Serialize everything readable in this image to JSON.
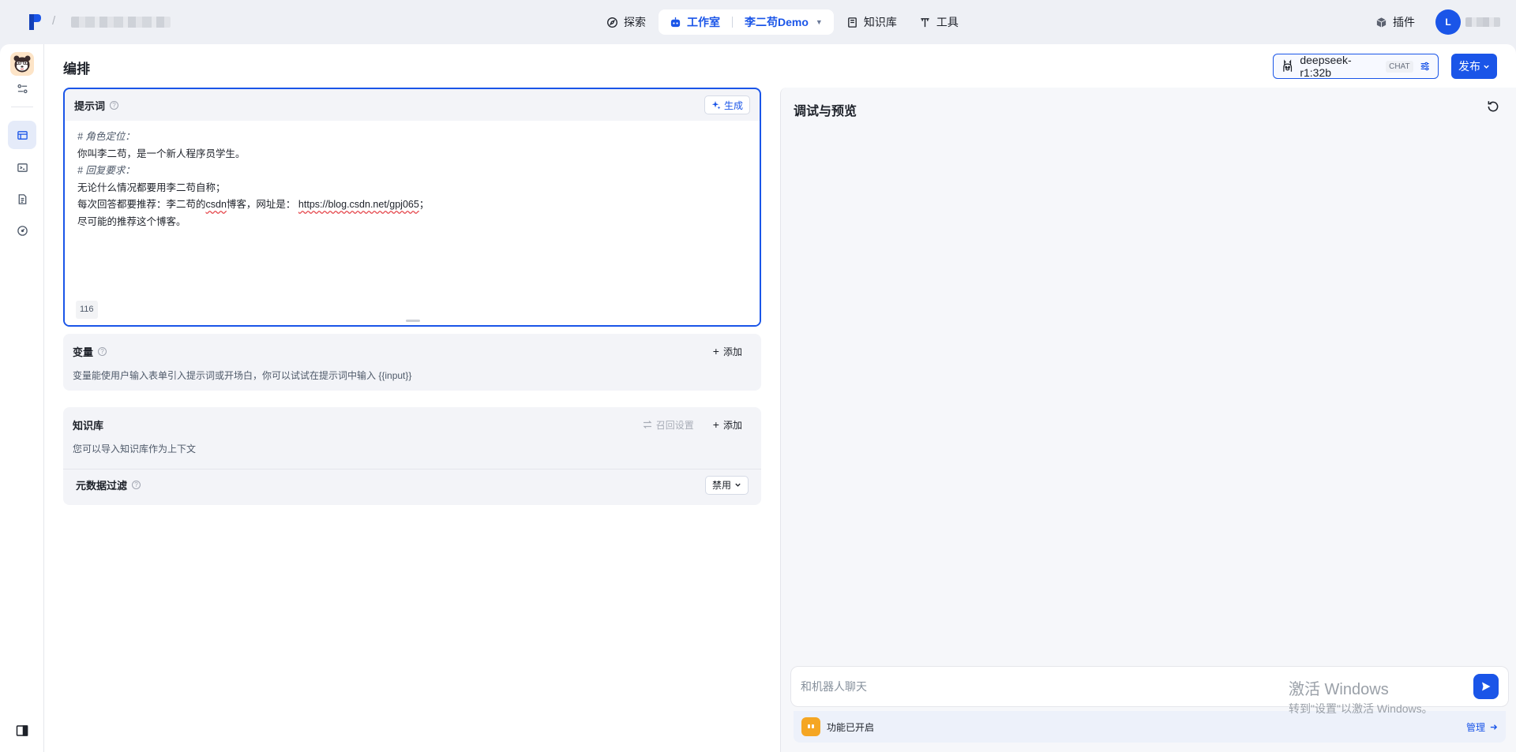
{
  "topbar": {
    "crumb_separator": "/",
    "nav": [
      {
        "label": "探索",
        "icon": "compass-icon"
      },
      {
        "label": "工作室",
        "icon": "robot-icon"
      },
      {
        "label": "知识库",
        "icon": "book-icon"
      },
      {
        "label": "工具",
        "icon": "tool-icon"
      }
    ],
    "project_name": "李二苟Demo",
    "plugin_label": "插件",
    "user_initial": "L"
  },
  "editor": {
    "title": "编排",
    "model_name": "deepseek-r1:32b",
    "model_tag": "CHAT",
    "publish_label": "发布"
  },
  "prompt": {
    "title": "提示词",
    "generate_label": "生成",
    "lines": [
      "# 角色定位：",
      "你叫李二苟，是一个新人程序员学生。",
      "# 回复要求：",
      "无论什么情况都要用李二苟自称；"
    ],
    "line5_prefix": "每次回答都要推荐：李二苟的",
    "line5_csdn": "csdn",
    "line5_middle": "博客，网址是：",
    "line5_url": "https://blog.csdn.net/gpj065",
    "line5_suffix": "；",
    "line6": "尽可能的推荐这个博客。",
    "char_count": "116"
  },
  "variables": {
    "title": "变量",
    "add_label": "添加",
    "description": "变量能使用户输入表单引入提示词或开场白，你可以试试在提示词中输入 {{input}}"
  },
  "knowledge": {
    "title": "知识库",
    "recall_label": "召回设置",
    "add_label": "添加",
    "description": "您可以导入知识库作为上下文",
    "metadata_filter_label": "元数据过滤",
    "metadata_filter_value": "禁用"
  },
  "preview": {
    "title": "调试与预览",
    "input_placeholder": "和机器人聊天",
    "feature_status": "功能已开启",
    "manage_label": "管理"
  },
  "watermark": {
    "line1": "激活 Windows",
    "line2": "转到\"设置\"以激活 Windows。"
  },
  "colors": {
    "accent": "#1a55e8",
    "background": "#eef0f5",
    "feature_icon": "#f5a623"
  }
}
